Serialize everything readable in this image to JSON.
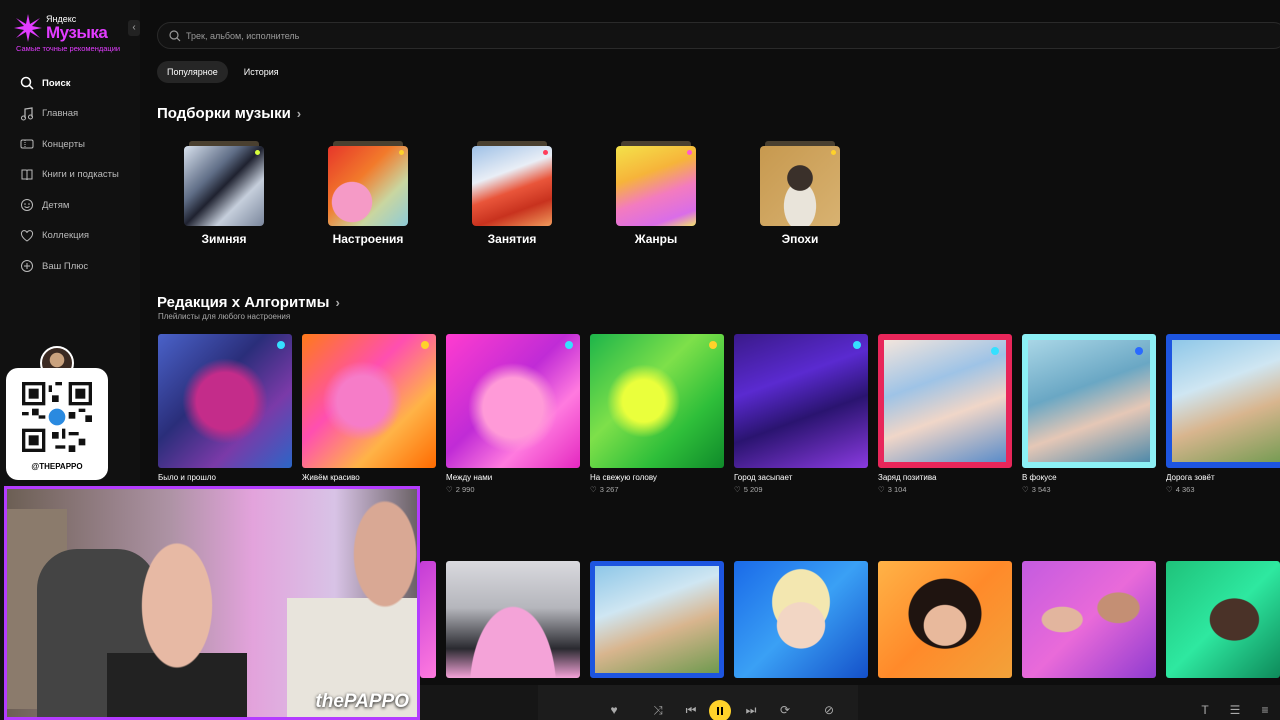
{
  "brand": {
    "small": "Яндекс",
    "name": "Музыка",
    "tagline": "Самые точные рекомендации",
    "accent": "#e23cff"
  },
  "sidebar": {
    "items": [
      {
        "label": "Поиск",
        "icon": "search-icon",
        "active": true
      },
      {
        "label": "Главная",
        "icon": "music-note-icon"
      },
      {
        "label": "Концерты",
        "icon": "ticket-icon"
      },
      {
        "label": "Книги и подкасты",
        "icon": "book-icon"
      },
      {
        "label": "Детям",
        "icon": "kids-icon"
      },
      {
        "label": "Коллекция",
        "icon": "heart-icon"
      },
      {
        "label": "Ваш Плюс",
        "icon": "plus-circle-icon"
      }
    ]
  },
  "search": {
    "placeholder": "Трек, альбом, исполнитель"
  },
  "tabs": [
    {
      "label": "Популярное",
      "active": true
    },
    {
      "label": "История",
      "active": false
    }
  ],
  "collections": {
    "title": "Подборки музыки",
    "items": [
      {
        "label": "Зимняя"
      },
      {
        "label": "Настроения"
      },
      {
        "label": "Занятия"
      },
      {
        "label": "Жанры"
      },
      {
        "label": "Эпохи"
      }
    ]
  },
  "editorial": {
    "title": "Редакция x Алгоритмы",
    "subtitle": "Плейлисты для любого настроения",
    "cards": [
      {
        "title": "Было и прошло",
        "likes": ""
      },
      {
        "title": "Живём красиво",
        "likes": ""
      },
      {
        "title": "Между нами",
        "likes": "2 990"
      },
      {
        "title": "На свежую голову",
        "likes": "3 267"
      },
      {
        "title": "Город засыпает",
        "likes": "5 209"
      },
      {
        "title": "Заряд позитива",
        "likes": "3 104"
      },
      {
        "title": "В фокусе",
        "likes": "3 543"
      },
      {
        "title": "Дорога зовёт",
        "likes": "4 363"
      }
    ]
  },
  "overlay": {
    "qr_handle": "@THEPAPPO",
    "webcam_brand": "thePAPPO"
  },
  "player": {
    "state": "playing",
    "accent": "#ffd22a"
  }
}
